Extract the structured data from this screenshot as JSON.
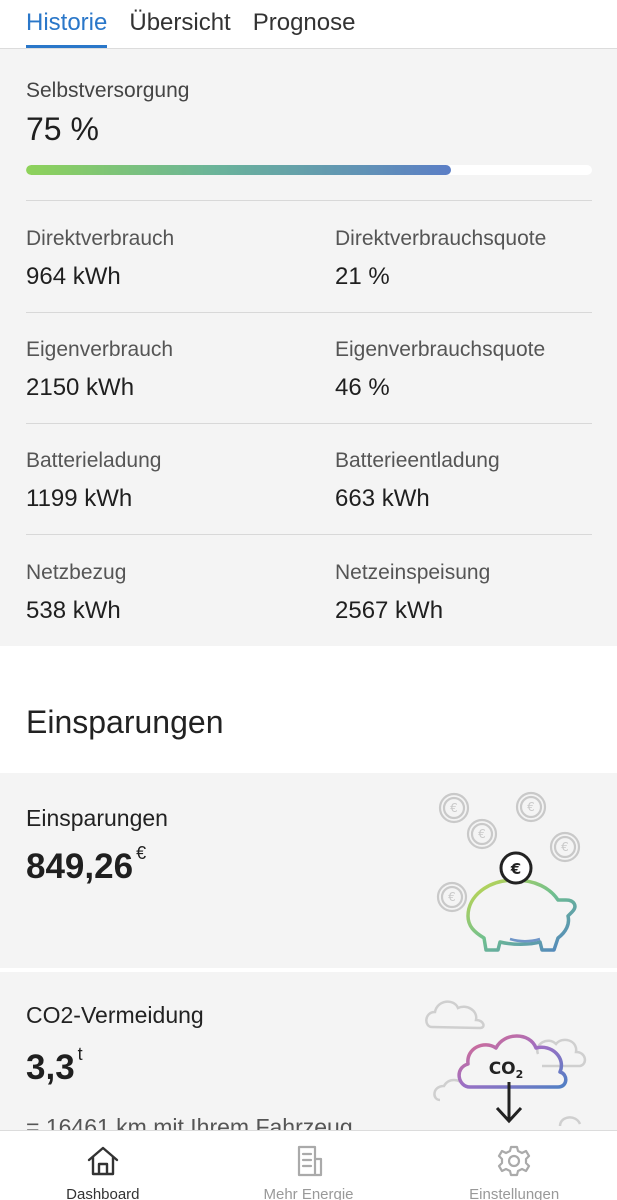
{
  "tabs": [
    {
      "label": "Historie"
    },
    {
      "label": "Übersicht"
    },
    {
      "label": "Prognose"
    }
  ],
  "selbstversorgung": {
    "label": "Selbstversorgung",
    "value": "75 %",
    "percent": 75
  },
  "stats": [
    {
      "left_label": "Direktverbrauch",
      "left_value": "964 kWh",
      "right_label": "Direktverbrauchsquote",
      "right_value": "21 %"
    },
    {
      "left_label": "Eigenverbrauch",
      "left_value": "2150 kWh",
      "right_label": "Eigenverbrauchsquote",
      "right_value": "46 %"
    },
    {
      "left_label": "Batterieladung",
      "left_value": "1199 kWh",
      "right_label": "Batterieentladung",
      "right_value": "663 kWh"
    },
    {
      "left_label": "Netzbezug",
      "left_value": "538 kWh",
      "right_label": "Netzeinspeisung",
      "right_value": "2567 kWh"
    }
  ],
  "einsparungen_section": {
    "heading": "Einsparungen"
  },
  "savings_card": {
    "label": "Einsparungen",
    "value": "849,26",
    "unit": "€",
    "coin_symbol": "€",
    "icon": "piggy-bank-icon"
  },
  "co2_card": {
    "label": "CO2-Vermeidung",
    "value": "3,3",
    "unit": "t",
    "km_text": "= 16461 km mit Ihrem Fahrzeug",
    "co2_symbol": "CO",
    "co2_sub": "2",
    "icon": "co2-cloud-icon"
  },
  "bottom_nav": [
    {
      "label": "Dashboard",
      "icon": "home-icon"
    },
    {
      "label": "Mehr Energie",
      "icon": "document-icon"
    },
    {
      "label": "Einstellungen",
      "icon": "gear-icon"
    }
  ],
  "colors": {
    "accent": "#2a77c9",
    "panel": "#f4f4f4",
    "bar_start": "#8ed25a",
    "bar_end": "#5b7ec6"
  }
}
